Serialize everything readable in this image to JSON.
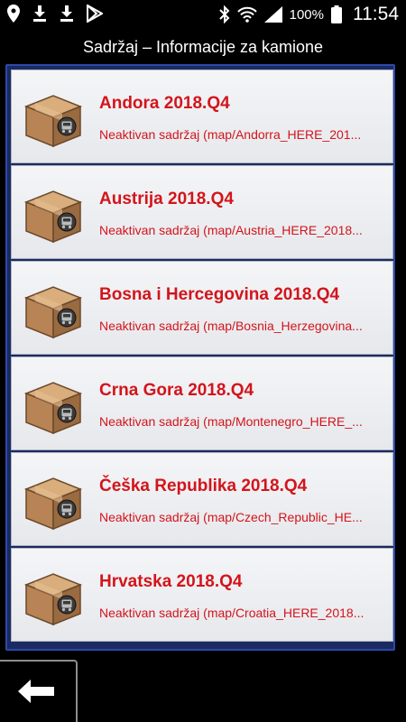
{
  "status_bar": {
    "battery_percent": "100%",
    "time": "11:54",
    "left_icons": [
      "location-icon",
      "download-icon",
      "download-icon",
      "play-store-icon"
    ],
    "right_icons": [
      "bluetooth-icon",
      "wifi-icon",
      "signal-icon",
      "battery-icon"
    ]
  },
  "header": {
    "title": "Sadržaj – Informacije za kamione"
  },
  "items": [
    {
      "name": "Andora 2018.Q4",
      "status": "Neaktivan sadržaj (map/Andorra_HERE_201..."
    },
    {
      "name": "Austrija 2018.Q4",
      "status": "Neaktivan sadržaj (map/Austria_HERE_2018..."
    },
    {
      "name": "Bosna i Hercegovina 2018.Q4",
      "status": "Neaktivan sadržaj (map/Bosnia_Herzegovina..."
    },
    {
      "name": "Crna Gora 2018.Q4",
      "status": "Neaktivan sadržaj (map/Montenegro_HERE_..."
    },
    {
      "name": "Češka Republika 2018.Q4",
      "status": "Neaktivan sadržaj (map/Czech_Republic_HE..."
    },
    {
      "name": "Hrvatska 2018.Q4",
      "status": "Neaktivan sadržaj (map/Croatia_HERE_2018..."
    }
  ],
  "back_button": {
    "icon": "back-arrow-icon"
  }
}
